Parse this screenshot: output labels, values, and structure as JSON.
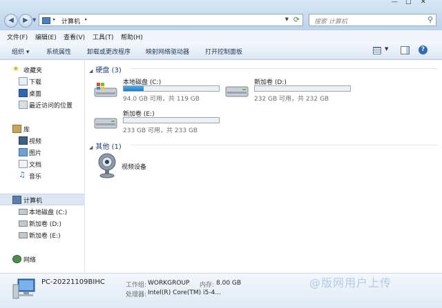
{
  "window": {
    "minimize_glyph": "—",
    "maximize_glyph": "□",
    "close_glyph": "✕"
  },
  "address": {
    "crumb": "计算机",
    "search_placeholder": "搜索 计算机"
  },
  "menu": [
    "文件(F)",
    "编辑(E)",
    "查看(V)",
    "工具(T)",
    "帮助(H)"
  ],
  "toolbar": {
    "organize": "组织 ▾",
    "system_properties": "系统属性",
    "uninstall": "卸载或更改程序",
    "map_drive": "映射网络驱动器",
    "control_panel": "打开控制面板"
  },
  "sidebar": {
    "favorites": "收藏夹",
    "downloads": "下载",
    "desktop": "桌面",
    "recent": "最近访问的位置",
    "libraries": "库",
    "videos": "视频",
    "pictures": "图片",
    "documents": "文档",
    "music": "音乐",
    "computer": "计算机",
    "drive_c": "本地磁盘 (C:)",
    "drive_d": "新加卷 (D:)",
    "drive_e": "新加卷 (E:)",
    "network": "网络"
  },
  "groups": {
    "hard_disks": "硬盘 (3)",
    "other": "其他 (1)"
  },
  "drives": [
    {
      "name": "本地磁盘 (C:)",
      "size_text": "94.0 GB 可用，共 119 GB",
      "used_fraction": 0.21
    },
    {
      "name": "新加卷 (D:)",
      "size_text": "232 GB 可用，共 232 GB",
      "used_fraction": 0.0
    },
    {
      "name": "新加卷 (E:)",
      "size_text": "233 GB 可用，共 233 GB",
      "used_fraction": 0.0
    }
  ],
  "other_items": {
    "webcam": "视频设备"
  },
  "details": {
    "pc_name": "PC-20221109BIHC",
    "workgroup_label": "工作组:",
    "workgroup_value": "WORKGROUP",
    "memory_label": "内存:",
    "memory_value": "8.00 GB",
    "processor_label": "处理器:",
    "processor_value": "Intel(R) Core(TM) i5-4..."
  },
  "watermark": "@版网用户上传",
  "colors": {
    "accent": "#1e79c9",
    "title_bar": "#c9dcef",
    "group_header": "#1e3f78"
  }
}
